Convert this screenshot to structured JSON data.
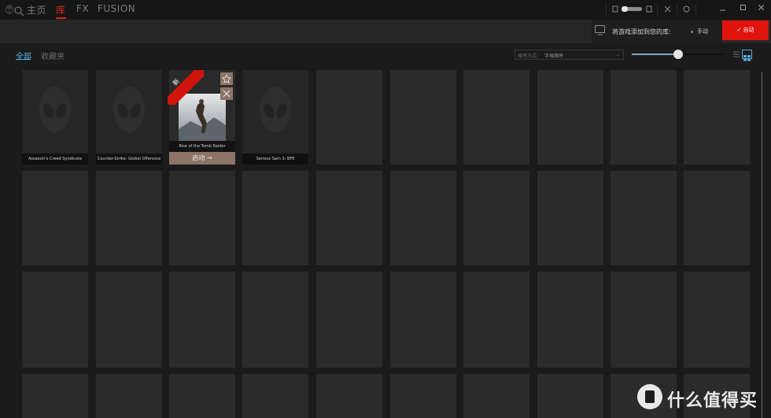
{
  "nav": {
    "items": [
      {
        "label": "主页",
        "active": false
      },
      {
        "label": "库",
        "active": true
      },
      {
        "label": "FX",
        "active": false
      },
      {
        "label": "FUSION",
        "active": false
      }
    ]
  },
  "window_controls": {
    "toggle_on": false,
    "icons": [
      "moon-icon",
      "sun-icon",
      "gamepad-settings-icon",
      "help-icon",
      "minimize-icon",
      "maximize-icon",
      "close-icon"
    ]
  },
  "add_games": {
    "label": "将游戏添加到您的库:",
    "manual_label": "手动",
    "auto_label": "✓ 自动"
  },
  "tabs": {
    "all": "全部",
    "favorites": "收藏夹"
  },
  "sort": {
    "label": "排序方式:",
    "value": "字母顺序"
  },
  "zoom": {
    "fraction": 0.5
  },
  "games": [
    {
      "title": "Assassin's Creed Syndicate"
    },
    {
      "title": "Counter-Strike: Global Offensive"
    },
    {
      "title": "Rise of the Tomb Raider",
      "badge": "新",
      "launch_label": "启动 →"
    },
    {
      "title": "Serious Sam 3: BFE"
    }
  ],
  "watermark": {
    "text": "什么值得买",
    "logo_char": "值"
  },
  "colors": {
    "accent_red": "#e0140c",
    "accent_blue": "#5aaee0",
    "launch_brown": "#8d7467"
  }
}
